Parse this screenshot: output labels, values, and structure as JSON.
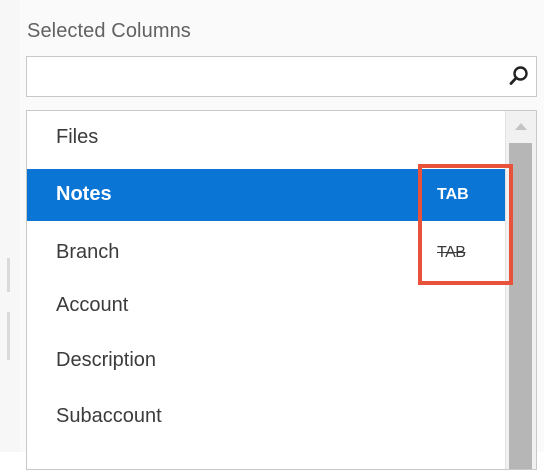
{
  "panel": {
    "title": "Selected Columns"
  },
  "search": {
    "value": "",
    "placeholder": "",
    "icon": "search-icon"
  },
  "list": {
    "items": [
      {
        "label": "Files",
        "selected": false,
        "marker": ""
      },
      {
        "label": "Notes",
        "selected": true,
        "marker": "TAB"
      },
      {
        "label": "Branch",
        "selected": false,
        "marker": "TAB"
      },
      {
        "label": "Account",
        "selected": false,
        "marker": ""
      },
      {
        "label": "Description",
        "selected": false,
        "marker": ""
      },
      {
        "label": "Subaccount",
        "selected": false,
        "marker": ""
      }
    ]
  },
  "colors": {
    "selected_row": "#0a75d4",
    "highlight_outline": "#e8513a",
    "scroll_thumb": "#b6b6b6"
  }
}
